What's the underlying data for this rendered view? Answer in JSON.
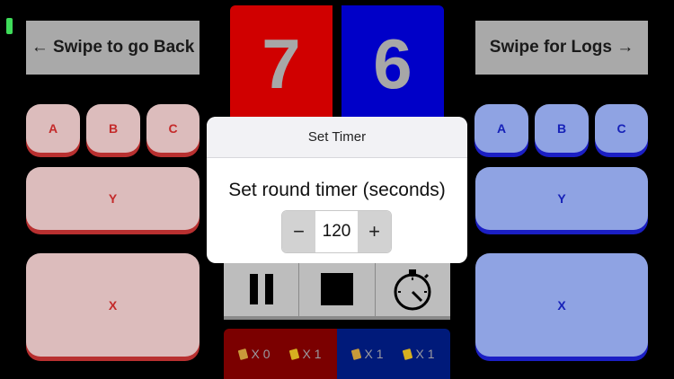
{
  "nav": {
    "back_label": "← Swipe to go Back",
    "logs_label": "Swipe for Logs →"
  },
  "scores": {
    "red": "7",
    "blue": "6"
  },
  "red_pads": {
    "a": "A",
    "b": "B",
    "c": "C",
    "y": "Y",
    "x": "X"
  },
  "blue_pads": {
    "a": "A",
    "b": "B",
    "c": "C",
    "y": "Y",
    "x": "X"
  },
  "controls": {
    "pause_icon": "pause-icon",
    "stop_icon": "stop-icon",
    "timer_icon": "stopwatch-icon"
  },
  "penalties": {
    "red_yellow_card": "X 0",
    "red_yellow_card_2": "X 1",
    "blue_yellow_card": "X 1",
    "blue_yellow_card_2": "X 1"
  },
  "dialog": {
    "title": "Set Timer",
    "message": "Set round timer (seconds)",
    "value": "120",
    "decrement": "−",
    "increment": "+"
  },
  "colors": {
    "red": "#d00000",
    "blue": "#0000c8",
    "status": "#3fdc5a"
  }
}
